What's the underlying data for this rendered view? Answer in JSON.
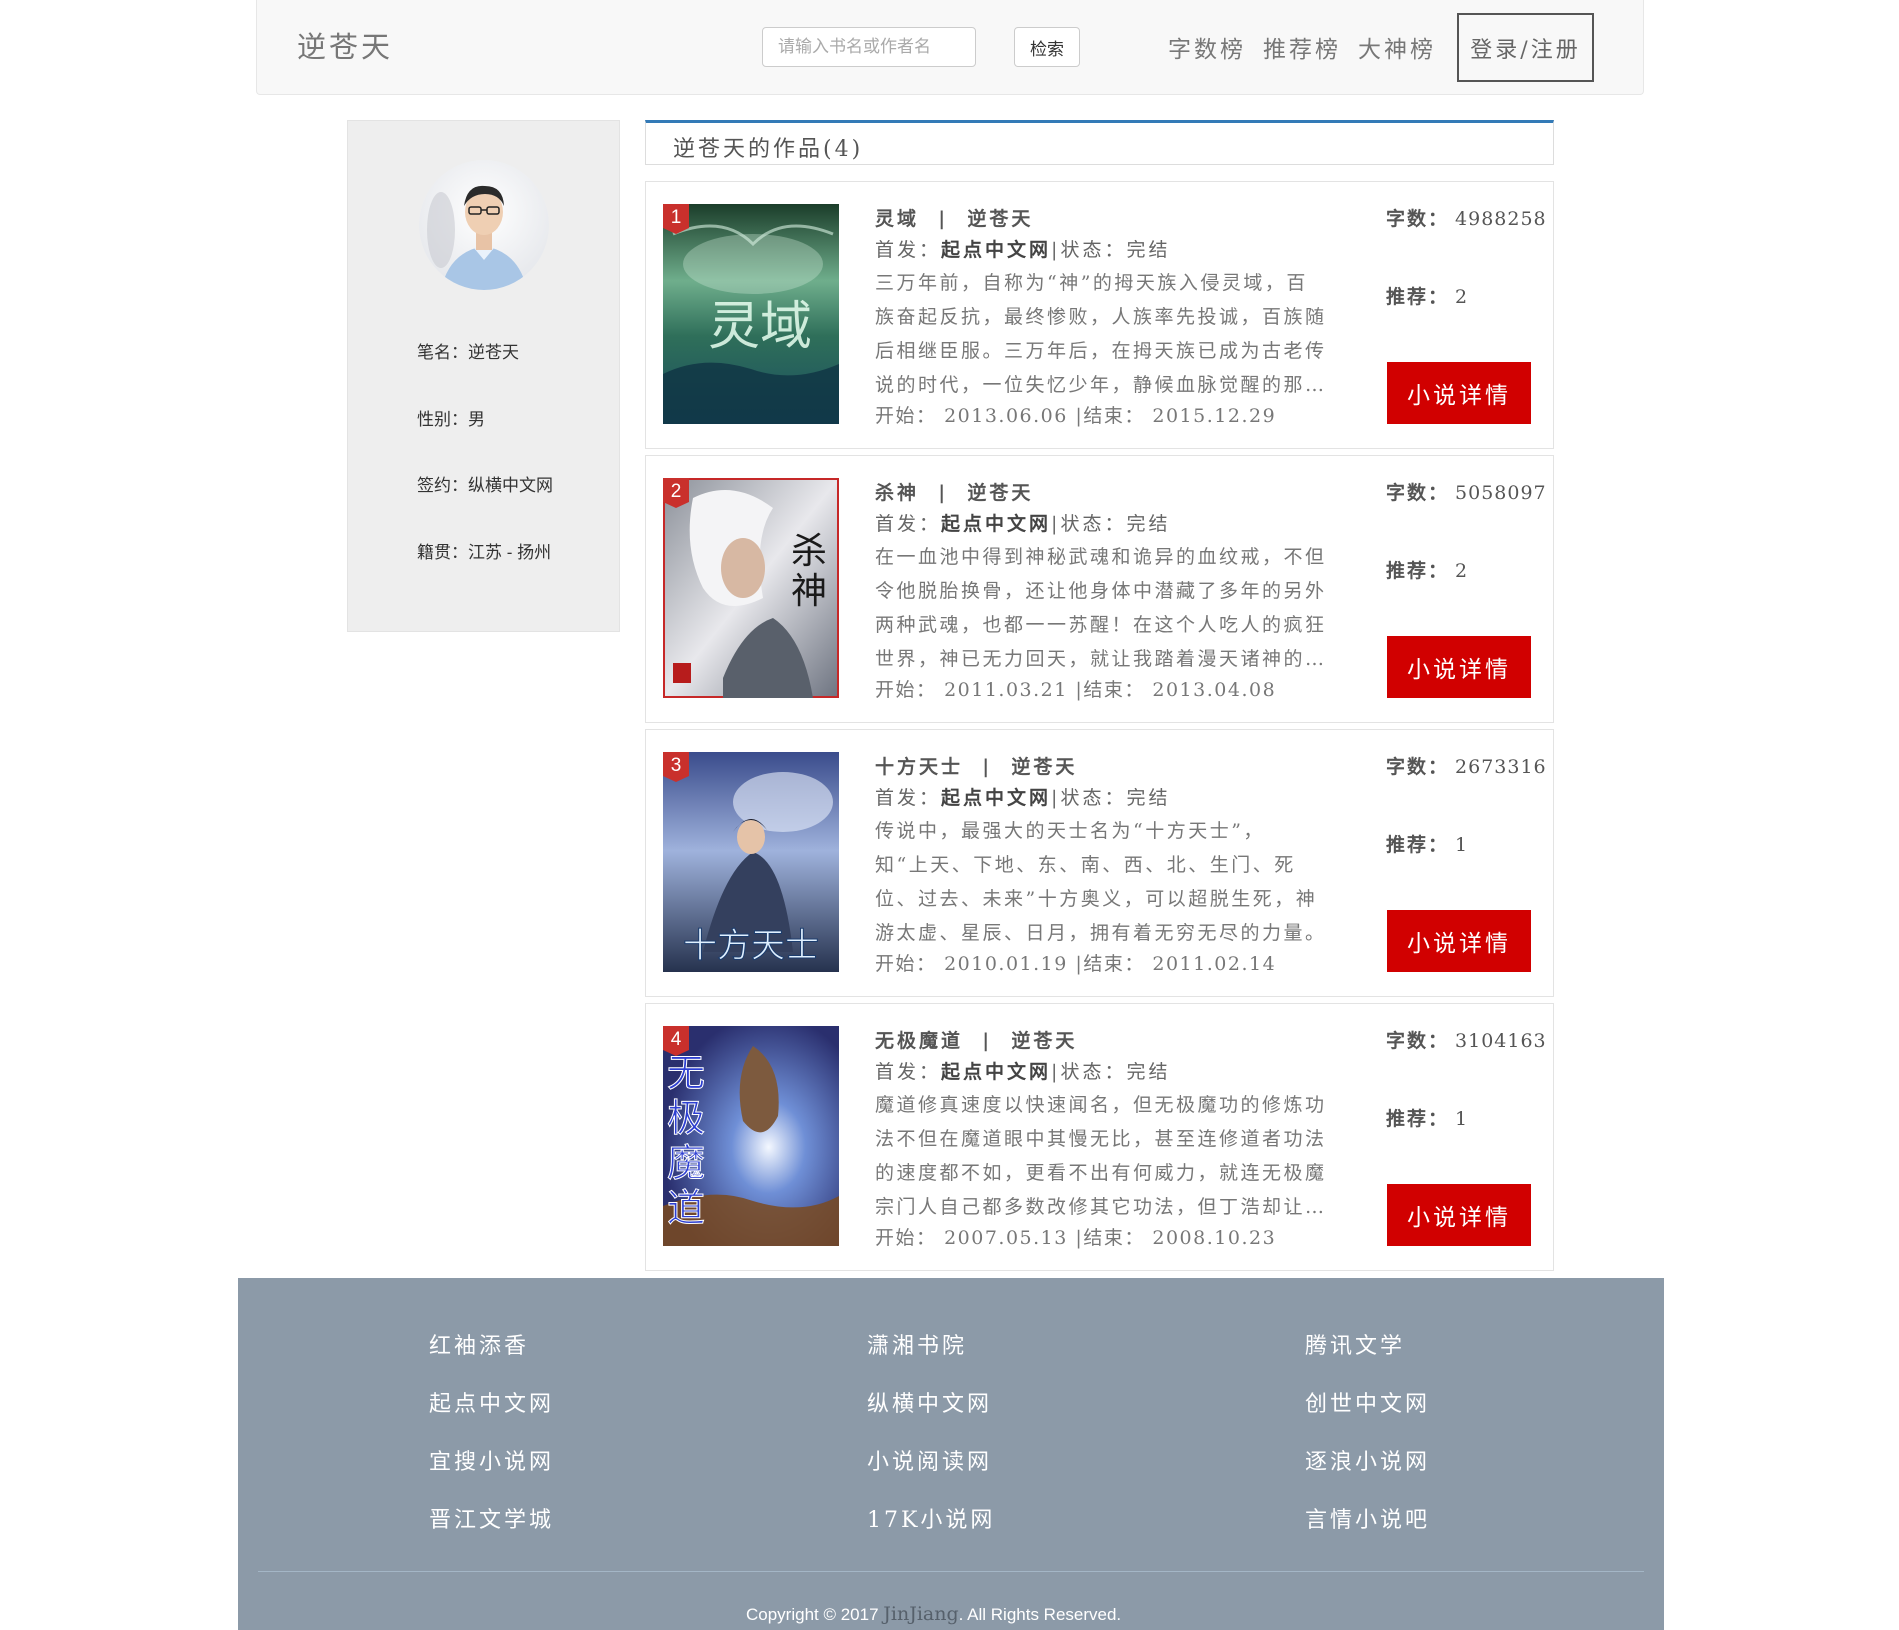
{
  "header": {
    "brand": "逆苍天",
    "search_placeholder": "请输入书名或作者名",
    "search_button": "检索",
    "nav": [
      "字数榜",
      "推荐榜",
      "大神榜"
    ],
    "login_button": "登录/注册"
  },
  "profile": {
    "penname": "笔名：逆苍天",
    "gender": "性别：男",
    "sign": "签约：纵横中文网",
    "origin": "籍贯：江苏 - 扬州"
  },
  "works": {
    "title": "逆苍天的作品(4)"
  },
  "labels": {
    "first_pub": "首发：",
    "status": "状态：",
    "start": "开始：",
    "end": "结束：",
    "words": "字数：",
    "recommend": "推荐：",
    "detail_button": "小说详情",
    "sep": "|"
  },
  "books": [
    {
      "rank": "1",
      "name": "灵域",
      "author": "逆苍天",
      "site": "起点中文网",
      "status": "完结",
      "desc": [
        "三万年前，自称为“神”的拇天族入侵灵域，百",
        "族奋起反抗，最终惨败，人族率先投诚，百族随",
        "后相继臣服。三万年后，在拇天族已成为古老传",
        "说的时代，一位失忆少年，静候血脉觉醒的那…"
      ],
      "start": "2013.06.06",
      "end": "2015.12.29",
      "words": "4988258",
      "recommend": "2",
      "cover_text": "灵域"
    },
    {
      "rank": "2",
      "name": "杀神",
      "author": "逆苍天",
      "site": "起点中文网",
      "status": "完结",
      "desc": [
        "在一血池中得到神秘武魂和诡异的血纹戒，不但",
        "令他脱胎换骨，还让他身体中潜藏了多年的另外",
        "两种武魂，也都一一苏醒！在这个人吃人的疯狂",
        "世界，神已无力回天，就让我踏着漫天诸神的…"
      ],
      "start": "2011.03.21",
      "end": "2013.04.08",
      "words": "5058097",
      "recommend": "2",
      "cover_text": "杀神"
    },
    {
      "rank": "3",
      "name": "十方天士",
      "author": "逆苍天",
      "site": "起点中文网",
      "status": "完结",
      "desc": [
        "传说中，最强大的天士名为“十方天士”，",
        "知“上天、下地、东、南、西、北、生门、死",
        "位、过去、未来”十方奥义，可以超脱生死，神",
        "游太虚、星辰、日月，拥有着无穷无尽的力量。"
      ],
      "start": "2010.01.19",
      "end": "2011.02.14",
      "words": "2673316",
      "recommend": "1",
      "cover_text": "十方天士"
    },
    {
      "rank": "4",
      "name": "无极魔道",
      "author": "逆苍天",
      "site": "起点中文网",
      "status": "完结",
      "desc": [
        "魔道修真速度以快速闻名，但无极魔功的修炼功",
        "法不但在魔道眼中其慢无比，甚至连修道者功法",
        "的速度都不如，更看不出有何威力，就连无极魔",
        "宗门人自己都多数改修其它功法，但丁浩却让…"
      ],
      "start": "2007.05.13",
      "end": "2008.10.23",
      "words": "3104163",
      "recommend": "1",
      "cover_text": "无极魔道"
    }
  ],
  "footer": {
    "links": [
      [
        "红袖添香",
        "潇湘书院",
        "腾讯文学"
      ],
      [
        "起点中文网",
        "纵横中文网",
        "创世中文网"
      ],
      [
        "宜搜小说网",
        "小说阅读网",
        "逐浪小说网"
      ],
      [
        "晋江文学城",
        "17K小说网",
        "言情小说吧"
      ]
    ],
    "copyright_prefix": "Copyright © 2017 ",
    "copyright_brand": "JinJiang",
    "copyright_suffix": ". All Rights Reserved."
  },
  "colors": {
    "accent_blue": "#337ab7",
    "detail_red": "#d10000",
    "footer_bg": "#8c9aa8"
  }
}
